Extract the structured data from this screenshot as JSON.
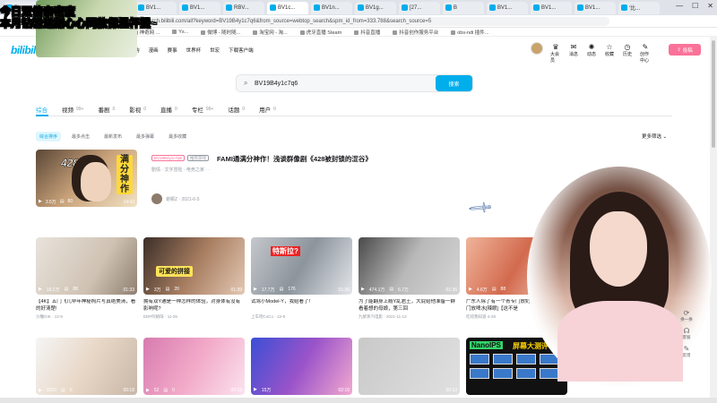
{
  "overlay": {
    "line1": "今日双倍亲密度",
    "line2": "本月钻粉送甜心心同款保温杯提~"
  },
  "browser": {
    "tabs": [
      "Bi",
      "BV1g...",
      "Bi",
      "BV1...",
      "BV1...",
      "RBV...",
      "BV1c...",
      "BV1n...",
      "BV1g...",
      "[27...",
      "B",
      "BV1...",
      "BV1...",
      "BV1...",
      "'比..."
    ],
    "active_tab_index": 6,
    "url": "search.bilibili.com/all?keyword=BV19B4y1c7q6&from_source=webtop_search&spm_id_from=333.788&search_source=5",
    "bookmarks": [
      "跟我一起",
      "北京师范大学 北...",
      "神奇网 ...",
      "Ys... ",
      "微博 - 随时随...",
      "淘宝网 - 淘...",
      "虎牙直播 Steam",
      "抖音直播",
      "抖音创作服务平台",
      "obs-ndi 插件..."
    ]
  },
  "header": {
    "logo": "bilibili",
    "nav": [
      "首页",
      "番剧",
      "直播",
      "游戏中心",
      "会员购",
      "漫画",
      "赛事",
      "世界杯",
      "世宏",
      "下载客户端"
    ],
    "right_nav": [
      {
        "icon": "crown-icon",
        "label": "大会员"
      },
      {
        "icon": "message-icon",
        "label": "消息"
      },
      {
        "icon": "dynamic-icon",
        "label": "动态"
      },
      {
        "icon": "star-icon",
        "label": "收藏"
      },
      {
        "icon": "history-icon",
        "label": "历史"
      },
      {
        "icon": "bulb-icon",
        "label": "创作中心"
      }
    ],
    "upload_label": "投稿"
  },
  "search": {
    "value": "BV19B4y1c7q6",
    "button": "搜索"
  },
  "categories": [
    {
      "label": "综合",
      "count": ""
    },
    {
      "label": "视频",
      "count": "99+"
    },
    {
      "label": "番剧",
      "count": "0"
    },
    {
      "label": "影视",
      "count": "0"
    },
    {
      "label": "直播",
      "count": "0"
    },
    {
      "label": "专栏",
      "count": "99+"
    },
    {
      "label": "话题",
      "count": "0"
    },
    {
      "label": "用户",
      "count": "0"
    }
  ],
  "sorts": [
    "综合排序",
    "最多点击",
    "最新发布",
    "最多弹幕",
    "最多收藏"
  ],
  "more_filter": "更多筛选",
  "featured": {
    "tag1": "BV19B4y1c7q6",
    "tag2": "推荐游戏",
    "title": "FAMI通满分神作！浅谈群像剧《428被封锁的涩谷》",
    "keywords": "剧情 · 文字冒险 · 电竞之家  ·  ·",
    "stats_play": "3.5万",
    "stats_dm": "80",
    "duration": "14:42",
    "thumb_big": "满分神作",
    "thumb_num": "428",
    "uploader": "谢顿Z · 2021-6-5"
  },
  "videos": [
    {
      "title": "【4K】五门飞儿早年神秘照片写真绝美清，看的好清楚!",
      "meta": "沙雕GIK · 12-9",
      "play": "19.2万",
      "dm": "88",
      "dur": "01:33"
    },
    {
      "title": "拥有双Y通是一种怎样的体验，对身体有没有影响呢?",
      "meta": "EDP阿娟呀 · 11-26",
      "play": "3万",
      "dm": "20",
      "dur": "01:39"
    },
    {
      "title": "试驾小Model-Y，我给看了!",
      "meta": "上车吧CoCo · 12-9",
      "play": "17.7万",
      "dm": "176",
      "dur": "01:36"
    },
    {
      "title": "为了能翻身上瘾Y乱君王，大屁给他准备一群看着想的母娘，第三回",
      "meta": "九黎蒸汽电影 · 2021-11-13",
      "play": "474.1万",
      "dm": "6.7万",
      "dur": "01:36"
    },
    {
      "title": "广东人除了有一个青专门放奶，还有一个青专门放啤水[辣眼]【这不是",
      "meta": "吃啥我知道·4-28",
      "play": "4.6万",
      "dm": "88",
      "dur": "01:29"
    },
    {
      "title": "",
      "meta": "",
      "play": "3220",
      "dm": "0",
      "dur": "00:18"
    },
    {
      "title": "",
      "meta": "",
      "play": "52",
      "dm": "0",
      "dur": "00:15"
    },
    {
      "title": "",
      "meta": "",
      "play": "15万",
      "dm": "",
      "dur": "02:16"
    },
    {
      "title": "",
      "meta": "",
      "play": "",
      "dm": "",
      "dur": "00:10"
    },
    {
      "title": "",
      "meta": "",
      "play": "",
      "dm": "",
      "dur": ""
    },
    {
      "title": "",
      "meta": "",
      "play": "",
      "dm": "",
      "dur": ""
    }
  ],
  "thumb_text": {
    "red": "特斯拉?",
    "yellow": "可爱的拼接",
    "nano": "NanoIPS",
    "nano2": "屏幕大测评"
  },
  "float_buttons": [
    {
      "icon": "refresh-icon",
      "label": "换一换"
    },
    {
      "icon": "service-icon",
      "label": "客服"
    },
    {
      "icon": "feedback-icon",
      "label": "反馈"
    }
  ]
}
